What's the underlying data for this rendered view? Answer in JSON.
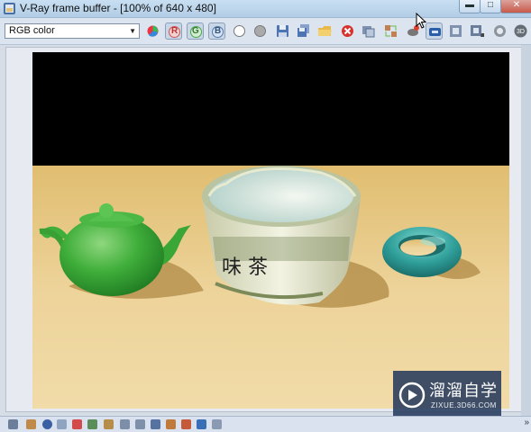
{
  "window": {
    "title": "V-Ray frame buffer - [100% of 640 x 480]",
    "minimize_glyph": "▬",
    "maximize_glyph": "□",
    "close_glyph": "✕"
  },
  "toolbar": {
    "channel_select_value": "RGB color",
    "red_channel_label": "R",
    "green_channel_label": "G",
    "blue_channel_label": "B"
  },
  "watermark": {
    "name": "溜溜自学",
    "url": "ZIXUE.3D66.COM"
  },
  "statusbar": {
    "more_glyph": "»"
  },
  "colors": {
    "titlebar": "#b2cde6",
    "toolbar": "#dce4ef",
    "floor": "#e3c27a",
    "background": "#000000",
    "teapot": "#3fae3a",
    "torus": "#35a5a0",
    "cup": "#e8ead4"
  }
}
